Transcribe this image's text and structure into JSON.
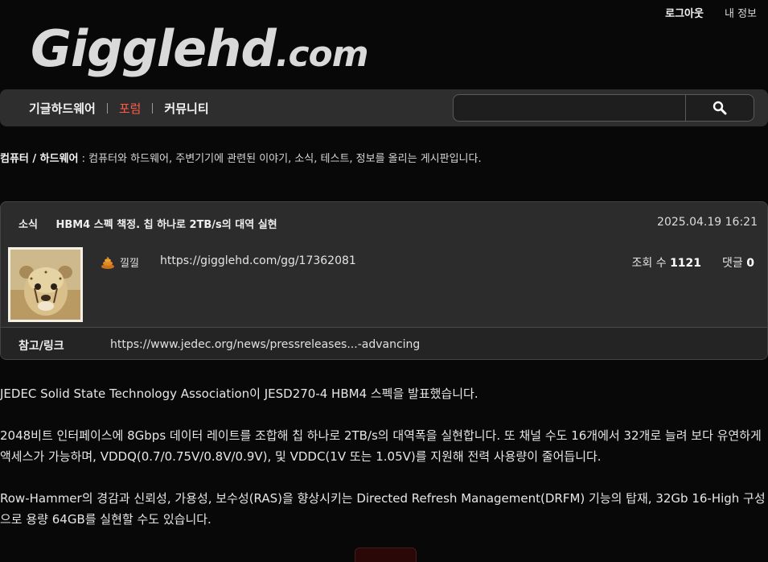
{
  "header": {
    "logout_label": "로그아웃",
    "myinfo_label": "내 정보",
    "logo_main": "Gigglehd",
    "logo_suffix": ".com"
  },
  "nav": {
    "items": [
      {
        "label": "기글하드웨어"
      },
      {
        "label": "포럼"
      },
      {
        "label": "커뮤니티"
      }
    ],
    "active_color": "#ff5a4a"
  },
  "search": {
    "value": "",
    "placeholder": ""
  },
  "board": {
    "name": "컴퓨터 / 하드웨어",
    "description": " : 컴퓨터와 하드웨어, 주변기기에 관련된 이야기, 소식, 테스트, 정보를 올리는 게시판입니다."
  },
  "post": {
    "category": "소식",
    "title": "HBM4 스펙 책정. 칩 하나로 2TB/s의 대역 실현",
    "date": "2025.04.19 16:21",
    "author": "낄낄",
    "url": "https://gigglehd.com/gg/17362081",
    "views_label": "조회 수",
    "views": "1121",
    "comments_label": "댓글",
    "comments": "0",
    "ref_label": "참고/링크",
    "ref_link": "https://www.jedec.org/news/pressreleases...-advancing"
  },
  "content": {
    "paragraphs": [
      "JEDEC Solid State Technology Association이 JESD270-4 HBM4 스펙을 발표했습니다.",
      "2048비트 인터페이스에 8Gbps 데이터 레이트를 조합해 칩 하나로 2TB/s의 대역폭을 실현합니다. 또 채널 수도 16개에서 32개로 늘려 보다 유연하게 액세스가 가능하며, VDDQ(0.7/0.75V/0.8V/0.9V), 및 VDDC(1V 또는 1.05V)를 지원해 전력 사용량이 줄어듭니다.",
      "Row-Hammer의 경감과 신뢰성, 가용성, 보수성(RAS)을 향상시키는 Directed Refresh Management(DRFM) 기능의 탑재, 32Gb 16-High 구성으로 용량 64GB를 실현할 수도 있습니다."
    ]
  }
}
